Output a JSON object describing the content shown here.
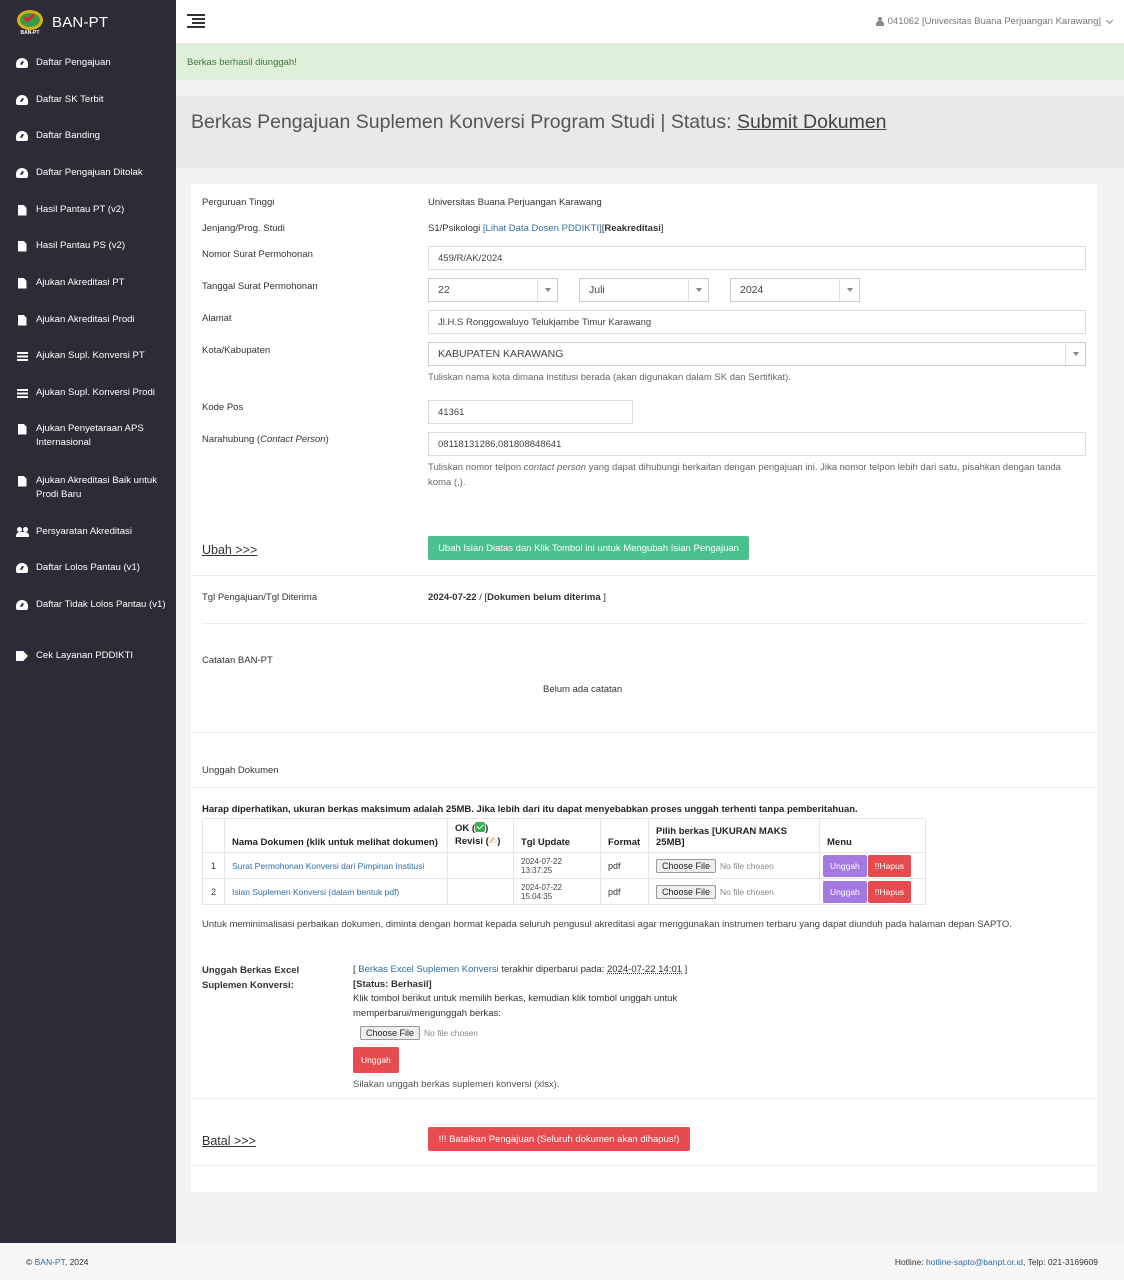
{
  "brand": {
    "name": "BAN-PT",
    "logo_caption": "BAN-PT"
  },
  "sidebar": {
    "items": [
      {
        "label": "Daftar Pengajuan",
        "icon": "gauge-icon"
      },
      {
        "label": "Daftar SK Terbit",
        "icon": "gauge-icon"
      },
      {
        "label": "Daftar Banding",
        "icon": "gauge-icon"
      },
      {
        "label": "Daftar Pengajuan Ditolak",
        "icon": "gauge-icon"
      },
      {
        "label": "Hasil Pantau PT (v2)",
        "icon": "file-text-icon"
      },
      {
        "label": "Hasil Pantau PS (v2)",
        "icon": "file-text-icon"
      },
      {
        "label": "Ajukan Akreditasi PT",
        "icon": "file-icon"
      },
      {
        "label": "Ajukan Akreditasi Prodi",
        "icon": "file-icon"
      },
      {
        "label": "Ajukan Supl. Konversi PT",
        "icon": "list-icon"
      },
      {
        "label": "Ajukan Supl. Konversi Prodi",
        "icon": "list-icon"
      },
      {
        "label": "Ajukan Penyetaraan APS Internasional",
        "icon": "file-icon"
      },
      {
        "label": "Ajukan Akreditasi Baik untuk Prodi Baru",
        "icon": "file-icon"
      },
      {
        "label": "Persyaratan Akreditasi",
        "icon": "users-icon"
      },
      {
        "label": "Daftar Lolos Pantau (v1)",
        "icon": "gauge-icon"
      },
      {
        "label": "Daftar Tidak Lolos Pantau (v1)",
        "icon": "gauge-icon"
      },
      {
        "label": "Cek Layanan PDDIKTI",
        "icon": "tags-icon"
      }
    ]
  },
  "topbar": {
    "user": "041062 [Universitas Buana Perjuangan Karawang]"
  },
  "alert": {
    "message": "Berkas berhasil diunggah!"
  },
  "header": {
    "title_prefix": "Berkas Pengajuan Suplemen Konversi Program Studi | Status:",
    "status": "Submit Dokumen"
  },
  "form": {
    "pt_label": "Perguruan Tinggi",
    "pt_value": "Universitas Buana Perjuangan Karawang",
    "prodi_label": "Jenjang/Prog. Studi",
    "prodi_value": "S1/Psikologi",
    "prodi_link": "[Lihat Data Dosen PDDIKTI]",
    "prodi_type_open": "[",
    "prodi_type": "Reakreditasi",
    "prodi_type_close": "]",
    "nomor_label": "Nomor Surat Permohonan",
    "nomor_value": "459/R/AK/2024",
    "tanggal_label": "Tanggal Surat Permohonan",
    "tanggal_day": "22",
    "tanggal_month": "Juli",
    "tanggal_year": "2024",
    "alamat_label": "Alamat",
    "alamat_value": "Jl.H.S Ronggowaluyo Telukjambe Timur Karawang",
    "kota_label": "Kota/Kabupaten",
    "kota_value": "KABUPATEN KARAWANG",
    "kota_help": "Tuliskan nama kota dimana institusi berada (akan digunakan dalam SK dan Sertifikat).",
    "kodepos_label": "Kode Pos",
    "kodepos_value": "41361",
    "narahubung_label": "Narahubung (",
    "narahubung_label_em": "Contact Person",
    "narahubung_label_close": ")",
    "narahubung_value": "08118131286,081808848641",
    "narahubung_help_1": "Tuliskan nomor telpon ",
    "narahubung_help_em": "contact person",
    "narahubung_help_2": " yang dapat dihubungi berkaitan dengan pengajuan ini. Jika nomor telpon lebih dari satu, pisahkan dengan tanda koma (,).",
    "ubah_link": "Ubah >>>",
    "ubah_button": "Ubah Isian Diatas dan Klik Tombol ini untuk Mengubah Isian Pengajuan"
  },
  "tgl": {
    "label": "Tgl Pengajuan/Tgl Diterima",
    "date": "2024-07-22",
    "sep": " / [",
    "status": "Dokumen belum diterima",
    "close": " ]"
  },
  "catatan": {
    "label": "Catatan BAN-PT",
    "value": "Belum ada catatan"
  },
  "unggah": {
    "label": "Unggah Dokumen",
    "notice": "Harap diperhatikan, ukuran berkas maksimum adalah 25MB. Jika lebih dari itu dapat menyebabkan proses unggah terhenti tanpa pemberitahuan.",
    "columns": {
      "nama": "Nama Dokumen (klik untuk melihat dokumen)",
      "ok_1": "OK (",
      "ok_2": ")",
      "revisi_1": "Revisi (",
      "revisi_2": ")",
      "tgl": "Tgl Update",
      "format": "Format",
      "pilih": "Pilih berkas [UKURAN MAKS 25MB]",
      "menu": "Menu"
    },
    "rows": [
      {
        "no": "1",
        "nama": "Surat Permohonan Konversi dari Pimpinan Institusi",
        "tgl": "2024-07-22 13:37:25",
        "format": "pdf"
      },
      {
        "no": "2",
        "nama": "Isian Suplemen Konversi (dalam bentuk pdf)",
        "tgl": "2024-07-22 15:04:35",
        "format": "pdf"
      }
    ],
    "choose_file": "Choose File",
    "no_file": "No file chosen",
    "unggah_btn": "Unggah",
    "hapus_btn": "!!Hapus",
    "info": "Untuk meminimalisasi perbaikan dokumen, diminta dengan hormat kepada seluruh pengusul akreditasi agar menggunakan instrumen terbaru yang dapat diunduh pada halaman depan SAPTO."
  },
  "excel": {
    "label_1": "Unggah Berkas Excel",
    "label_2": "Suplemen Konversi:",
    "open": "[ ",
    "link": "Berkas Excel Suplemen Konversi",
    "updated_text": " terakhir diperbarui pada: ",
    "updated": "2024-07-22 14:01",
    "close": " ]",
    "status": "[Status: Berhasil]",
    "instr": "Klik tombol berikut untuk memilih berkas, kemudian klik tombol unggah untuk memperbarui/mengunggah berkas:",
    "choose_file": "Choose File",
    "no_file": "No file chosen",
    "unggah_btn": "Unggah",
    "help": "Silakan unggah berkas suplemen konversi (xlsx)."
  },
  "batal": {
    "link": "Batal >>>",
    "button": "!!! Batalkan Pengajuan (Seluruh dokumen akan dihapus!)"
  },
  "footer": {
    "copy_prefix": "© ",
    "copy_link": "BAN-PT",
    "copy_suffix": ", 2024",
    "hotline_label": "Hotline: ",
    "hotline_email": "hotline-sapto@banpt.or.id",
    "telp": ", Telp: 021-3169609"
  },
  "colors": {
    "sidebar": "#2b2c35",
    "success_bg": "#dff0d8",
    "green_btn": "#4ac18e",
    "red_btn": "#e64c4f",
    "purple_btn": "#a47ae2"
  }
}
